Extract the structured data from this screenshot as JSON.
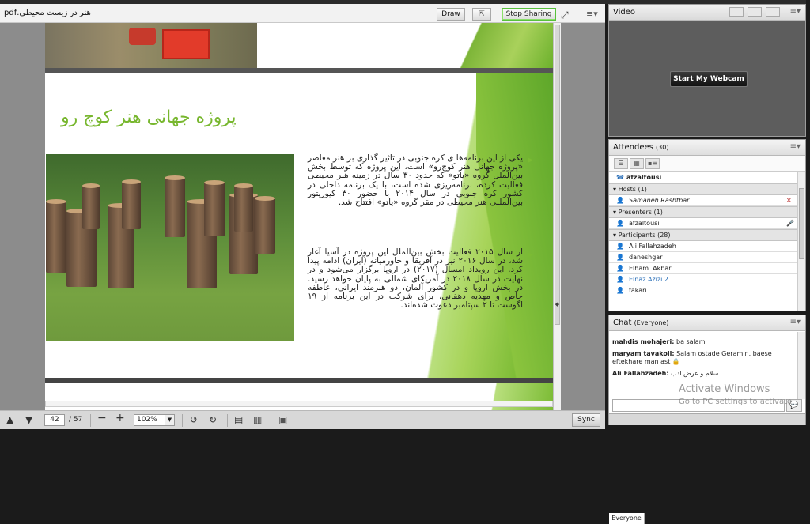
{
  "share_pod": {
    "file_title": "هنر در زیست محیطی.pdf",
    "toolbar": {
      "draw_label": "Draw",
      "stop_sharing_label": "Stop Sharing"
    },
    "slide": {
      "title": "پروژه جهانی هنر کوچ رو",
      "paragraph1": "یکی از این برنامه‌ها ی کره جنوبی در تاثیر گذاری بر هنر معاصر «پروژه جهانی هنر کوچ‌رو» است، این پروژه که توسط بخش بین‌الملل گروه «یاتو» که حدود ۳۰ سال در زمینه هنر محیطی فعالیت کرده، برنامه‌ریزی شده است، با یک برنامه داخلی در کشور کره جنوبی در سال ۲۰۱۴ با حضور ۳۰ کیوریتور بین‌المللی هنر محیطی در مقر گروه «یاتو» افتتاح شد.",
      "paragraph2": "از سال ۲۰۱۵ فعالیت بخش بین‌الملل این پروژه در آسیا آغاز شد، در سال ۲۰۱۶ نیز در آفریقا و خاورمیانه (ایران) ادامه پیدا کرد. این رویداد امسال (۲۰۱۷) در اروپا برگزار می‌شود و در نهایت در سال ۲۰۱۸ در آمریکای شمالی به پایان خواهد رسید. در بخش اروپا و در کشور آلمان، دو هنرمند ایرانی، عاطفه خاص و مهدیه دهقانی، برای شرکت در این برنامه از ۱۹ اگوست تا ۲ سپتامبر دعوت شده‌اند."
    },
    "footer": {
      "page_current": "42",
      "page_total": "/ 57",
      "zoom": "102%",
      "sync_label": "Sync"
    }
  },
  "video_pod": {
    "title": "Video",
    "webcam_button": "Start My Webcam"
  },
  "attendees_pod": {
    "title": "Attendees",
    "count": "(30)",
    "me": "afzaltousi",
    "groups": {
      "hosts": "Hosts (1)",
      "presenters": "Presenters (1)",
      "participants": "Participants (28)"
    },
    "hosts": [
      "Samaneh Rashtbar"
    ],
    "presenters": [
      "afzaltousi"
    ],
    "participants": [
      "Ali Fallahzadeh",
      "daneshgar",
      "Elham. Akbari",
      "Elnaz Azizi 2",
      "fakari"
    ]
  },
  "chat_pod": {
    "title": "Chat",
    "scope": "(Everyone)",
    "messages": [
      {
        "sender": "mahdis mohajeri:",
        "text": "ba salam"
      },
      {
        "sender": "maryam tavakoli:",
        "text": "Salam ostade Geramin. baese eftekhare man ast"
      },
      {
        "sender": "Ali Fallahzadeh:",
        "text": "سلام و عرض ادب"
      }
    ],
    "tab_label": "Everyone"
  },
  "watermark": {
    "line1": "Activate Windows",
    "line2": "Go to PC settings to activate"
  },
  "colors": {
    "accent_green": "#7bbb34",
    "stop_sharing_border": "#58c13c",
    "link_blue": "#2a6fb8"
  }
}
